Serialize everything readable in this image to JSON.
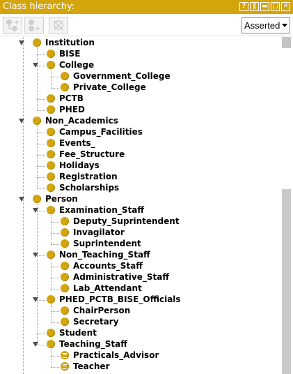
{
  "panel": {
    "title": "Class hierarchy:",
    "controls": [
      "?",
      "‖",
      "▬",
      "□",
      "✕"
    ]
  },
  "toolbar": {
    "add_subclass": "add-subclass-icon",
    "add_sibling": "add-sibling-icon",
    "delete_class": "delete-class-icon",
    "view_mode": "Asserted"
  },
  "tree": [
    {
      "label": "Institution",
      "depth": 0,
      "expanded": true
    },
    {
      "label": "BISE",
      "depth": 1
    },
    {
      "label": "College",
      "depth": 1,
      "expanded": true
    },
    {
      "label": "Government_College",
      "depth": 2
    },
    {
      "label": "Private_College",
      "depth": 2
    },
    {
      "label": "PCTB",
      "depth": 1
    },
    {
      "label": "PHED",
      "depth": 1
    },
    {
      "label": "Non_Academics",
      "depth": 0,
      "expanded": true
    },
    {
      "label": "Campus_Facilities",
      "depth": 1
    },
    {
      "label": "Events_",
      "depth": 1
    },
    {
      "label": "Fee_Structure",
      "depth": 1
    },
    {
      "label": "Holidays",
      "depth": 1
    },
    {
      "label": "Registration",
      "depth": 1
    },
    {
      "label": "Scholarships",
      "depth": 1
    },
    {
      "label": "Person",
      "depth": 0,
      "expanded": true
    },
    {
      "label": "Examination_Staff",
      "depth": 1,
      "expanded": true
    },
    {
      "label": "Deputy_Suprintendent",
      "depth": 2
    },
    {
      "label": "Invagilator",
      "depth": 2
    },
    {
      "label": "Suprintendent",
      "depth": 2
    },
    {
      "label": "Non_Teaching_Staff",
      "depth": 1,
      "expanded": true
    },
    {
      "label": "Accounts_Staff",
      "depth": 2
    },
    {
      "label": "Administrative_Staff",
      "depth": 2
    },
    {
      "label": "Lab_Attendant",
      "depth": 2
    },
    {
      "label": "PHED_PCTB_BISE_Officials",
      "depth": 1,
      "expanded": true
    },
    {
      "label": "ChairPerson",
      "depth": 2
    },
    {
      "label": "Secretary",
      "depth": 2
    },
    {
      "label": "Student",
      "depth": 1
    },
    {
      "label": "Teaching_Staff",
      "depth": 1,
      "expanded": true
    },
    {
      "label": "Practicals_Advisor",
      "depth": 2,
      "icon": "defined-class"
    },
    {
      "label": "Teacher",
      "depth": 2,
      "icon": "defined-class"
    }
  ],
  "colors": {
    "accent": "#d4a40c",
    "class_dot": "#d2a60c"
  }
}
